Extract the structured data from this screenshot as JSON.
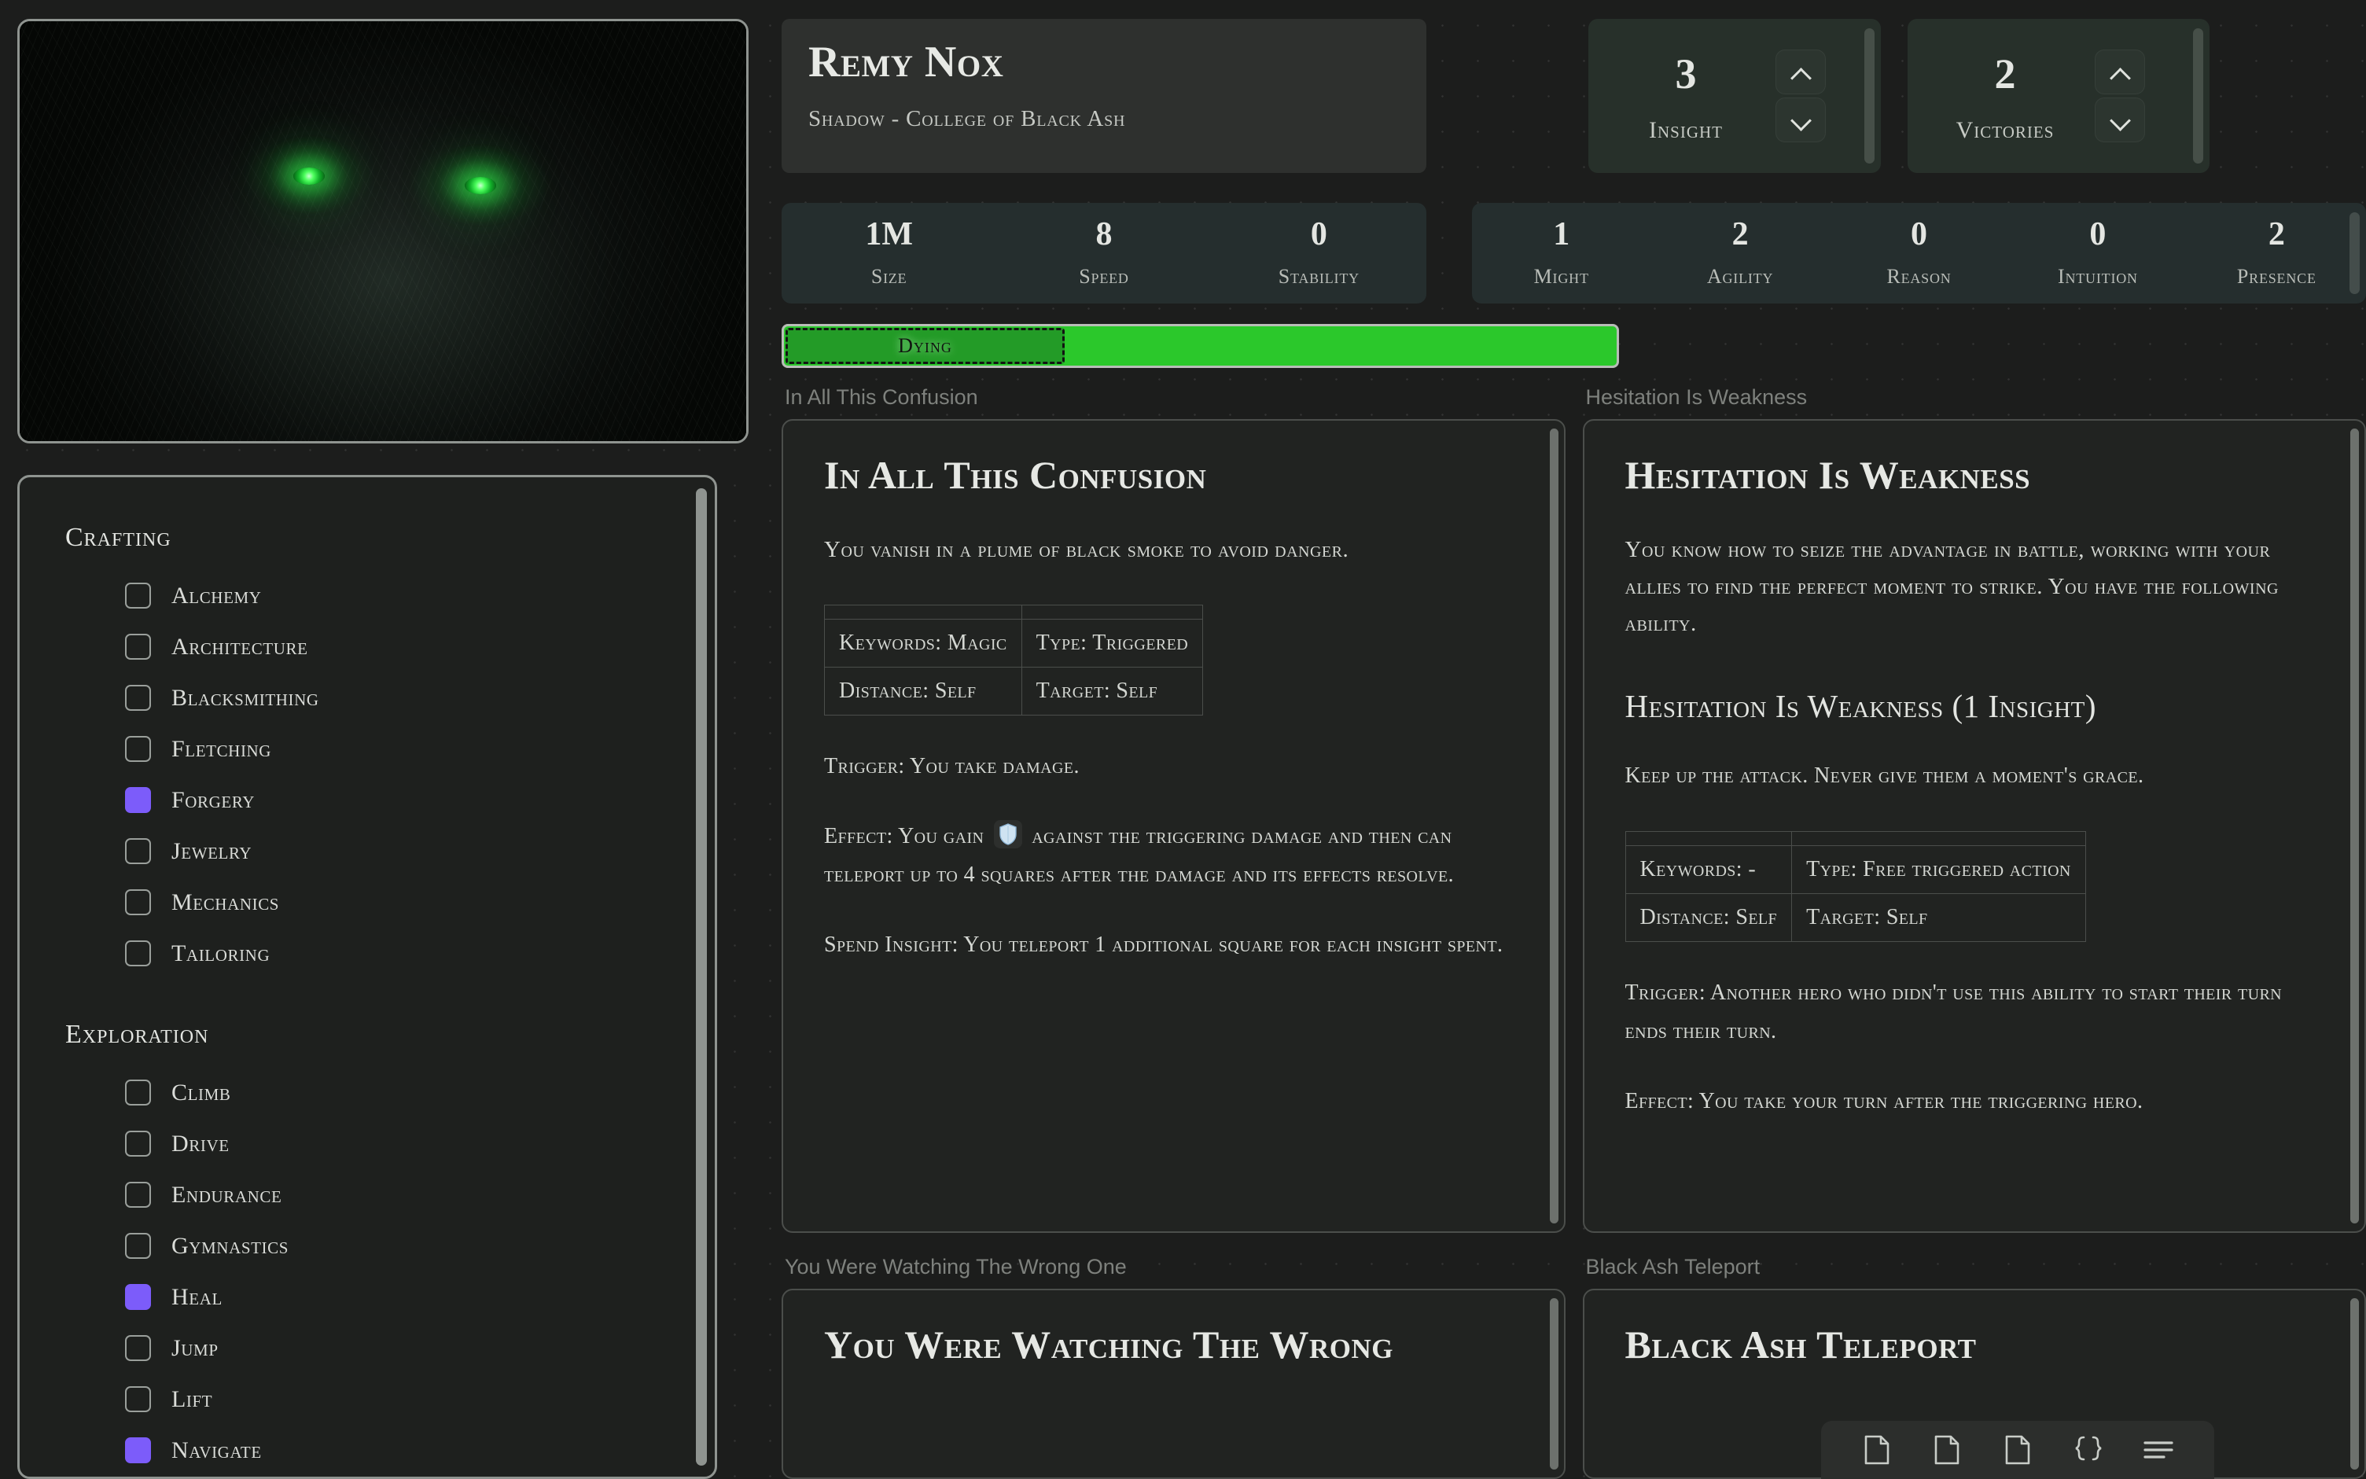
{
  "hero": {
    "name": "Remy Nox",
    "subtitle": "Shadow - College of Black Ash"
  },
  "counters": [
    {
      "value": "3",
      "label": "Insight",
      "name": "insight"
    },
    {
      "value": "2",
      "label": "Victories",
      "name": "victories"
    }
  ],
  "basic_stats": [
    {
      "value": "1M",
      "label": "Size"
    },
    {
      "value": "8",
      "label": "Speed"
    },
    {
      "value": "0",
      "label": "Stability"
    }
  ],
  "ability_scores": [
    {
      "value": "1",
      "label": "Might"
    },
    {
      "value": "2",
      "label": "Agility"
    },
    {
      "value": "0",
      "label": "Reason"
    },
    {
      "value": "0",
      "label": "Intuition"
    },
    {
      "value": "2",
      "label": "Presence"
    }
  ],
  "stamina": {
    "dying_label": "Dying",
    "dying_color": "#239b27",
    "healthy_color": "#2bc82b"
  },
  "skills": {
    "groups": [
      {
        "title": "Crafting",
        "items": [
          {
            "label": "Alchemy",
            "checked": false
          },
          {
            "label": "Architecture",
            "checked": false
          },
          {
            "label": "Blacksmithing",
            "checked": false
          },
          {
            "label": "Fletching",
            "checked": false
          },
          {
            "label": "Forgery",
            "checked": true
          },
          {
            "label": "Jewelry",
            "checked": false
          },
          {
            "label": "Mechanics",
            "checked": false
          },
          {
            "label": "Tailoring",
            "checked": false
          }
        ]
      },
      {
        "title": "Exploration",
        "items": [
          {
            "label": "Climb",
            "checked": false
          },
          {
            "label": "Drive",
            "checked": false
          },
          {
            "label": "Endurance",
            "checked": false
          },
          {
            "label": "Gymnastics",
            "checked": false
          },
          {
            "label": "Heal",
            "checked": true
          },
          {
            "label": "Jump",
            "checked": false
          },
          {
            "label": "Lift",
            "checked": false
          },
          {
            "label": "Navigate",
            "checked": true
          }
        ]
      }
    ]
  },
  "checked_color": "#7c5cfa",
  "cards": {
    "slot_labels": {
      "top_left": "In All This Confusion",
      "top_right": "Hesitation Is Weakness",
      "bottom_left": "You Were Watching The Wrong One",
      "bottom_right": "Black Ash Teleport"
    },
    "confusion": {
      "title": "In All This Confusion",
      "flavor": "You vanish in a plume of black smoke to avoid danger.",
      "meta": [
        [
          "Keywords: Magic",
          "Type: Triggered"
        ],
        [
          "Distance: Self",
          "Target: Self"
        ]
      ],
      "trigger": "Trigger: You take damage.",
      "effect_before": "Effect: You gain",
      "effect_after": "against the triggering damage and then can teleport up to 4 squares after the damage and its effects resolve.",
      "spend": "Spend Insight: You teleport 1 additional square for each insight spent."
    },
    "hesitation": {
      "title": "Hesitation Is Weakness",
      "flavor": "You know how to seize the advantage in battle, working with your allies to find the perfect moment to strike. You have the following ability.",
      "subtitle": "Hesitation Is Weakness (1 Insight)",
      "quote": "Keep up the attack. Never give them a moment's grace.",
      "meta": [
        [
          "Keywords: -",
          "Type: Free triggered action"
        ],
        [
          "Distance: Self",
          "Target: Self"
        ]
      ],
      "trigger": "Trigger: Another hero who didn't use this ability to start their turn ends their turn.",
      "effect": "Effect: You take your turn after the triggering hero."
    },
    "watching": {
      "title": "You Were Watching The Wrong"
    },
    "teleport": {
      "title": "Black Ash Teleport"
    }
  },
  "toolbar": {
    "buttons": [
      {
        "icon": "document-icon"
      },
      {
        "icon": "document-icon"
      },
      {
        "icon": "document-icon"
      },
      {
        "icon": "brackets-icon"
      },
      {
        "icon": "list-icon"
      }
    ]
  }
}
